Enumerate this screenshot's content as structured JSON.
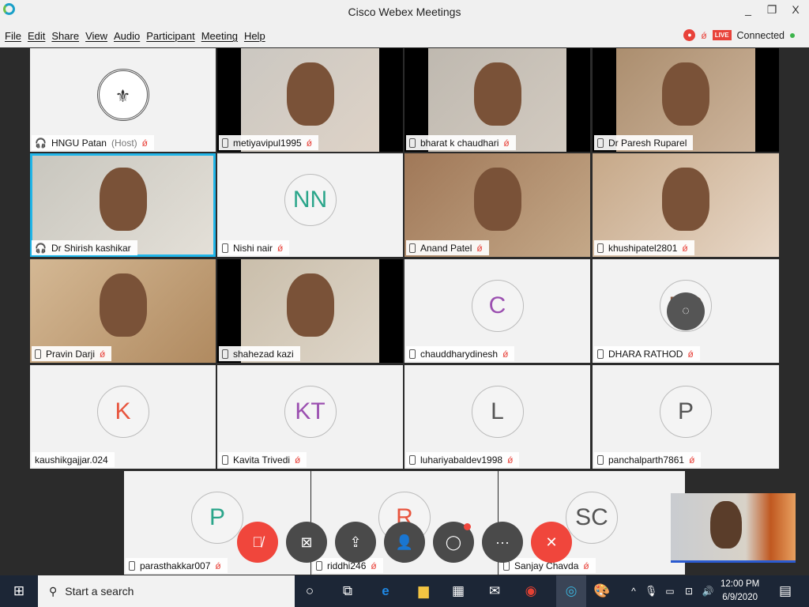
{
  "window": {
    "title": "Cisco Webex Meetings",
    "minimize": "_",
    "maximize": "❐",
    "close": "X"
  },
  "menu": [
    "File",
    "Edit",
    "Share",
    "View",
    "Audio",
    "Participant",
    "Meeting",
    "Help"
  ],
  "status": {
    "record_icon": "record-icon",
    "live": "LIVE",
    "connection": "Connected",
    "connected_color": "#3cb44b"
  },
  "participants": [
    {
      "name": "HNGU Patan",
      "role": "(Host)",
      "type": "logo",
      "device": "headset-icon",
      "muted": true
    },
    {
      "name": "metiyavipul1995",
      "type": "video",
      "device": "phone-icon",
      "muted": true
    },
    {
      "name": "bharat k chaudhari",
      "type": "video",
      "device": "phone-icon",
      "muted": true
    },
    {
      "name": "Dr Paresh Ruparel",
      "type": "video",
      "device": "phone-icon",
      "muted": false
    },
    {
      "name": "Dr Shirish kashikar",
      "type": "video",
      "device": "headset-icon",
      "muted": false,
      "active_speaker": true
    },
    {
      "name": "Nishi nair",
      "type": "avatar",
      "initials": "NN",
      "color": "#2aa58a",
      "device": "phone-icon",
      "muted": true
    },
    {
      "name": "Anand Patel",
      "type": "video",
      "device": "phone-icon",
      "muted": true
    },
    {
      "name": "khushipatel2801",
      "type": "video",
      "device": "phone-icon",
      "muted": true
    },
    {
      "name": "Pravin Darji",
      "type": "video",
      "device": "phone-icon",
      "muted": true
    },
    {
      "name": "shahezad kazi",
      "type": "video",
      "device": "phone-icon",
      "muted": false
    },
    {
      "name": "chauddharydinesh",
      "type": "avatar",
      "initials": "C",
      "color": "#9b4fb0",
      "device": "phone-icon",
      "muted": true
    },
    {
      "name": "DHARA RATHOD",
      "type": "avatar",
      "initials": "DR",
      "color": "#8a5a40",
      "device": "phone-icon",
      "muted": true,
      "chat_bubble": true
    },
    {
      "name": "kaushikgajjar.024",
      "type": "avatar",
      "initials": "K",
      "color": "#e8553e",
      "device": "",
      "muted": false
    },
    {
      "name": "Kavita Trivedi",
      "type": "avatar",
      "initials": "KT",
      "color": "#9b4fb0",
      "device": "phone-icon",
      "muted": true
    },
    {
      "name": "luhariyabaldev1998",
      "type": "avatar",
      "initials": "L",
      "color": "#555555",
      "device": "phone-icon",
      "muted": true
    },
    {
      "name": "panchalparth7861",
      "type": "avatar",
      "initials": "P",
      "color": "#555555",
      "device": "phone-icon",
      "muted": true
    },
    {
      "name": "parasthakkar007",
      "type": "avatar",
      "initials": "P",
      "color": "#2aa58a",
      "device": "phone-icon",
      "muted": true
    },
    {
      "name": "riddhi246",
      "type": "avatar",
      "initials": "R",
      "color": "#e8553e",
      "device": "phone-icon",
      "muted": true
    },
    {
      "name": "Sanjay Chavda",
      "type": "avatar",
      "initials": "SC",
      "color": "#555555",
      "device": "phone-icon",
      "muted": true
    }
  ],
  "controls": [
    {
      "name": "mute-button",
      "icon": "mic-off-icon",
      "glyph": "🎙̸",
      "red": true
    },
    {
      "name": "video-button",
      "icon": "video-off-icon",
      "glyph": "⊠"
    },
    {
      "name": "share-button",
      "icon": "share-icon",
      "glyph": "⇪"
    },
    {
      "name": "participants-button",
      "icon": "participants-icon",
      "glyph": "👤"
    },
    {
      "name": "chat-button",
      "icon": "chat-icon",
      "glyph": "◯",
      "badge": true
    },
    {
      "name": "more-button",
      "icon": "more-icon",
      "glyph": "···"
    },
    {
      "name": "leave-button",
      "icon": "close-icon",
      "glyph": "✕",
      "red": true
    }
  ],
  "taskbar": {
    "search_placeholder": "Start a search",
    "time": "12:00 PM",
    "date": "6/9/2020"
  }
}
